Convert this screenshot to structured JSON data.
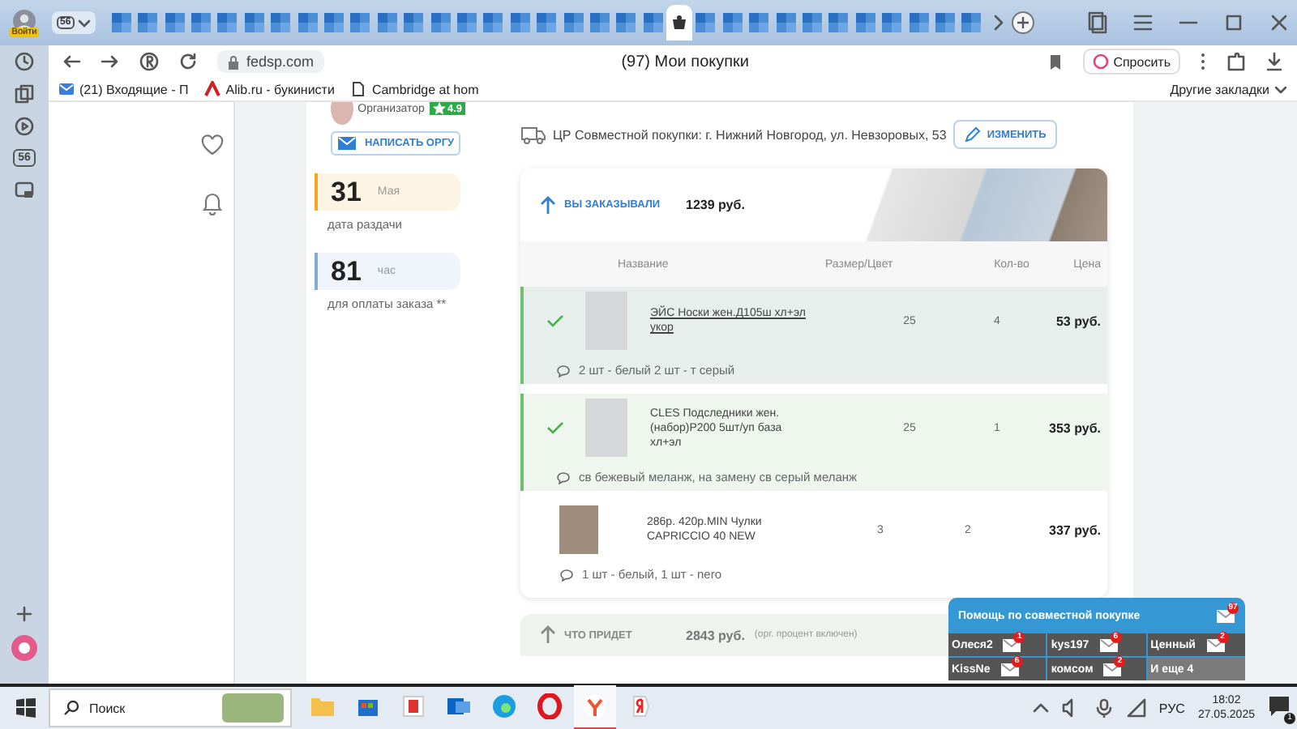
{
  "browser": {
    "profile_label": "Войти",
    "tab_group": "56",
    "tabs": [
      {
        "selected": false
      },
      {
        "selected": false
      },
      {
        "selected": false
      },
      {
        "selected": false
      },
      {
        "selected": false
      },
      {
        "selected": false
      },
      {
        "selected": false
      },
      {
        "selected": false
      },
      {
        "selected": false
      },
      {
        "selected": false
      },
      {
        "selected": false
      },
      {
        "selected": false
      },
      {
        "selected": false
      },
      {
        "selected": false
      },
      {
        "selected": false
      },
      {
        "selected": false
      },
      {
        "selected": false
      },
      {
        "selected": false
      },
      {
        "selected": false
      },
      {
        "selected": false
      },
      {
        "selected": false
      },
      {
        "selected": true
      },
      {
        "selected": false
      },
      {
        "selected": false
      },
      {
        "selected": false
      },
      {
        "selected": false
      },
      {
        "selected": false
      },
      {
        "selected": false
      },
      {
        "selected": false
      },
      {
        "selected": false
      },
      {
        "selected": false
      },
      {
        "selected": false
      },
      {
        "selected": false
      }
    ],
    "address": "fedsp.com",
    "page_title": "(97) Мои покупки",
    "ask_button": "Спросить",
    "bookmarks": [
      {
        "kind": "mail",
        "label": "(21) Входящие - П"
      },
      {
        "kind": "alib",
        "label": "Alib.ru - букинисти"
      },
      {
        "kind": "page",
        "label": "Cambridge at hom"
      }
    ],
    "other_bookmarks": "Другие закладки"
  },
  "sidebar": {
    "badge": "56"
  },
  "organizer": {
    "role": "Организатор",
    "rating": "4.9",
    "write_button": "НАПИСАТЬ ОРГУ"
  },
  "deadlines": [
    {
      "number": "31",
      "unit": "Мая",
      "caption": "дата раздачи",
      "color": "#f5a623"
    },
    {
      "number": "81",
      "unit": "час",
      "caption": "для оплаты заказа **",
      "color": "#86a8dc"
    }
  ],
  "delivery": {
    "address": "ЦР Совместной покупки: г. Нижний Новгород, ул. Невзоровых, 53",
    "change_button": "ИЗМЕНИТЬ"
  },
  "ordered": {
    "label": "ВЫ ЗАКАЗЫВАЛИ",
    "total": "1239 руб."
  },
  "table": {
    "columns": [
      "Название",
      "Размер/Цвет",
      "Кол-во",
      "Цена"
    ],
    "rows": [
      {
        "name": "ЭЙС Носки жен.Д105ш хл+эл укор",
        "size": "25",
        "qty": "4",
        "price": "53 руб.",
        "comment": "2 шт - белый 2 шт - т серый",
        "confirmed": true,
        "highlighted": true
      },
      {
        "name": "CLES Подследники жен.(набор)Р200 5шт/уп база хл+эл",
        "size": "25",
        "qty": "1",
        "price": "353 руб.",
        "comment": "св бежевый меланж, на замену св серый меланж",
        "confirmed": true,
        "highlighted": false
      },
      {
        "name": "286р. 420р.MIN Чулки CAPRICCIO 40 NEW",
        "size": "3",
        "qty": "2",
        "price": "337 руб.",
        "comment": "1 шт - белый, 1 шт - nero",
        "confirmed": false,
        "highlighted": false
      }
    ]
  },
  "arriving": {
    "label": "ЧТО ПРИДЕТ",
    "total": "2843 руб.",
    "note": "(орг. процент включен)"
  },
  "help_widget": {
    "title": "Помощь по совместной покупке",
    "badge": "97",
    "contacts": [
      {
        "name": "Олеся2",
        "count": "1"
      },
      {
        "name": "kys197",
        "count": "6"
      },
      {
        "name": "Ценный",
        "count": "2"
      },
      {
        "name": "KissNe",
        "count": "6"
      },
      {
        "name": "комсом",
        "count": "2"
      }
    ],
    "more": "И еще 4"
  },
  "taskbar": {
    "search": "Поиск",
    "language": "РУС",
    "time": "18:02",
    "date": "27.05.2025",
    "notifications": "1"
  }
}
